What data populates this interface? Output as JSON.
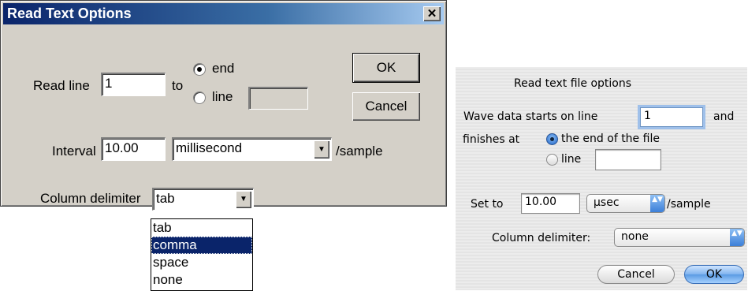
{
  "win_dialog": {
    "title": "Read Text Options",
    "close_glyph": "✕",
    "read_line_label": "Read line",
    "read_line_value": "1",
    "to_label": "to",
    "radio_end_label": "end",
    "radio_line_label": "line",
    "line_value": "",
    "ok_label": "OK",
    "cancel_label": "Cancel",
    "interval_label": "Interval",
    "interval_value": "10.00",
    "unit_selected": "millisecond",
    "per_sample_label": "/sample",
    "column_delim_label": "Column delimiter",
    "column_delim_selected": "tab",
    "dropdown_arrow": "▼",
    "delim_options": [
      "tab",
      "comma",
      "space",
      "none"
    ],
    "highlighted_option": "comma"
  },
  "mac_dialog": {
    "title": "Read text file options",
    "starts_label": "Wave data starts on line",
    "start_value": "1",
    "and_label": "and",
    "finishes_label": "finishes at",
    "radio_end_label": "the end of the file",
    "radio_line_label": "line",
    "line_value": "",
    "set_to_label": "Set to",
    "set_to_value": "10.00",
    "unit_selected": "μsec",
    "per_sample_label": "/sample",
    "column_delim_label": "Column delimiter:",
    "column_delim_selected": "none",
    "popup_arrows": "▲▼",
    "cancel_label": "Cancel",
    "ok_label": "OK"
  }
}
